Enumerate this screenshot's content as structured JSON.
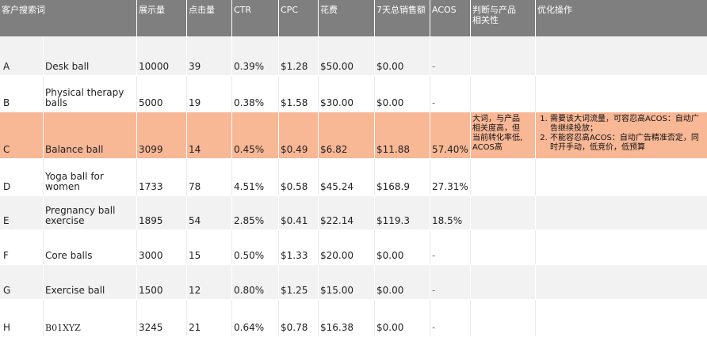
{
  "headers": {
    "term": "客户搜索词",
    "impressions": "展示量",
    "clicks": "点击量",
    "ctr": "CTR",
    "cpc": "CPC",
    "spend": "花费",
    "sales": "7天总销售额",
    "acos": "ACOS",
    "relevance": "判断与产品\n相关性",
    "action": "优化操作"
  },
  "rows": [
    {
      "id": "A",
      "term": "Desk ball",
      "impressions": "10000",
      "clicks": "39",
      "ctr": "0.39%",
      "cpc": "$1.28",
      "spend": "$50.00",
      "sales": "$0.00",
      "acos": "-"
    },
    {
      "id": "B",
      "term": "Physical therapy balls",
      "impressions": "5000",
      "clicks": "19",
      "ctr": "0.38%",
      "cpc": "$1.58",
      "spend": "$30.00",
      "sales": "$0.00",
      "acos": "-"
    },
    {
      "id": "C",
      "term": "Balance ball",
      "impressions": "3099",
      "clicks": "14",
      "ctr": "0.45%",
      "cpc": "$0.49",
      "spend": "$6.82",
      "sales": "$11.88",
      "acos": "57.40%",
      "relevance": "大词，与产品\n相关度高，但\n当前转化率低,\nACOS高",
      "actions": [
        "需要该大词流量，可容忍高ACOS：自动广告继续投放；",
        "不能容忍高ACOS：自动广告精准否定，同时开手动，低竞价，低预算"
      ]
    },
    {
      "id": "D",
      "term": "Yoga ball for women",
      "impressions": "1733",
      "clicks": "78",
      "ctr": "4.51%",
      "cpc": "$0.58",
      "spend": "$45.24",
      "sales": "$168.9",
      "acos": "27.31%"
    },
    {
      "id": "E",
      "term": "Pregnancy ball exercise",
      "impressions": "1895",
      "clicks": "54",
      "ctr": "2.85%",
      "cpc": "$0.41",
      "spend": "$22.14",
      "sales": "$119.3",
      "acos": "18.5%"
    },
    {
      "id": "F",
      "term": "Core balls",
      "impressions": "3000",
      "clicks": "15",
      "ctr": "0.50%",
      "cpc": "$1.33",
      "spend": "$20.00",
      "sales": "$0.00",
      "acos": "-"
    },
    {
      "id": "G",
      "term": "Exercise ball",
      "impressions": "1500",
      "clicks": "12",
      "ctr": "0.80%",
      "cpc": "$1.25",
      "spend": "$15.00",
      "sales": "$0.00",
      "acos": "-"
    },
    {
      "id": "H",
      "term": "B01XYZ",
      "impressions": "3245",
      "clicks": "21",
      "ctr": "0.64%",
      "cpc": "$0.78",
      "spend": "$16.38",
      "sales": "$0.00",
      "acos": "-"
    }
  ],
  "colors": {
    "header_bg": "#7f7f7f",
    "highlight_row": "#f8b795",
    "stripe": "#f2f2f2"
  }
}
